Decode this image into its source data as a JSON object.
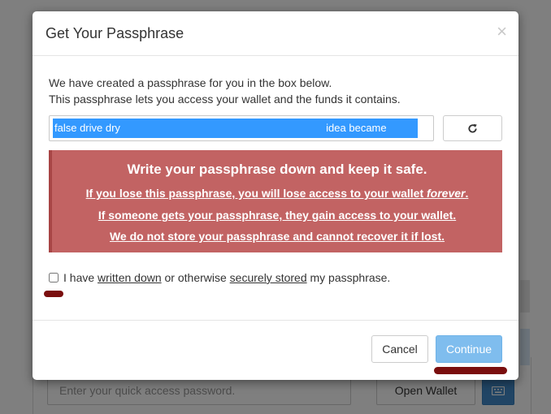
{
  "background": {
    "password_placeholder": "Enter your quick access password.",
    "open_wallet_label": "Open Wallet",
    "keyboard_icon": "keyboard-icon"
  },
  "modal": {
    "title": "Get Your Passphrase",
    "close_glyph": "×",
    "intro_line1": "We have created a passphrase for you in the box below.",
    "intro_line2": "This passphrase lets you access your wallet and the funds it contains.",
    "passphrase": {
      "visible_start": "false drive dry",
      "visible_end": "idea became"
    },
    "regenerate_icon": "refresh-icon",
    "warning": {
      "heading": "Write your passphrase down and keep it safe.",
      "line1_prefix": "If you lose this passphrase, you will lose access to your wallet ",
      "line1_emph": "forever",
      "line1_suffix": ".",
      "line2": "If someone gets your passphrase, they gain access to your wallet.",
      "line3": "We do not store your passphrase and cannot recover it if lost."
    },
    "acknowledge": {
      "prefix": "I have ",
      "link1": "written down",
      "middle": " or otherwise ",
      "link2": "securely stored",
      "suffix": " my passphrase.",
      "checked": false
    },
    "cancel_label": "Cancel",
    "continue_label": "Continue"
  },
  "colors": {
    "warning_bg": "#c26363",
    "continue_bg": "#7fbdee",
    "selection": "#3399ff"
  }
}
